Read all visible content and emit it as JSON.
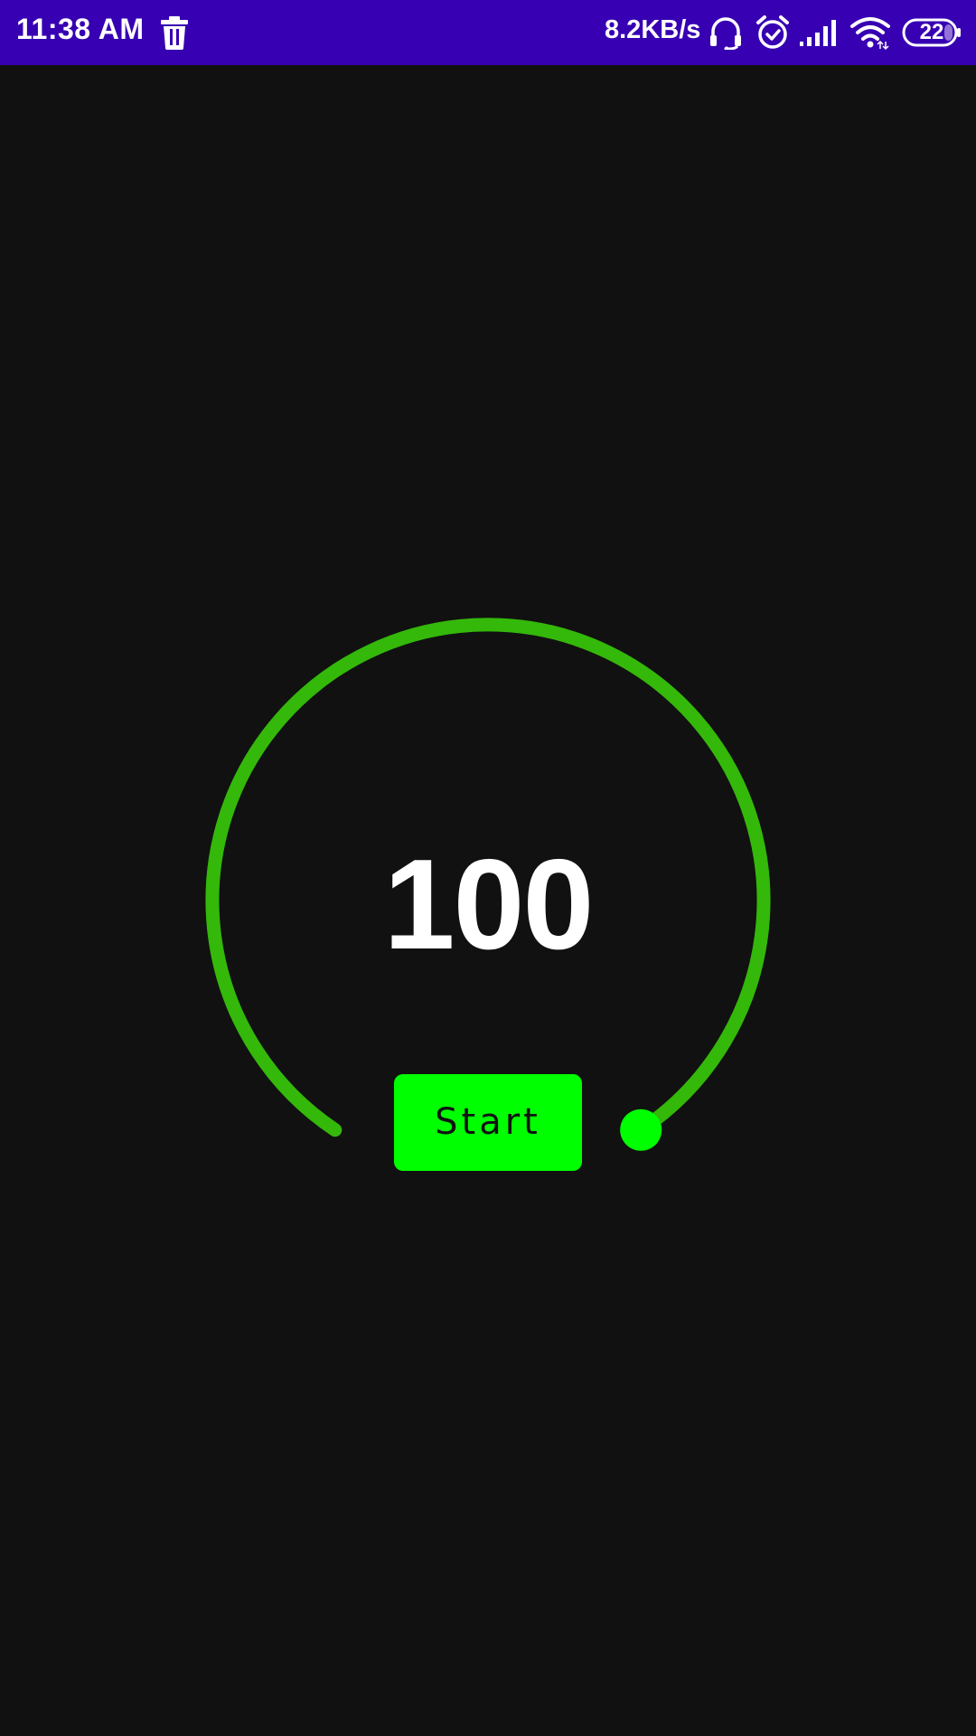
{
  "status_bar": {
    "time": "11:38 AM",
    "network_speed": "8.2KB/s",
    "battery_level": "22",
    "icons": [
      "trash-icon",
      "headset-icon",
      "alarm-icon",
      "signal-icon",
      "wifi-icon",
      "battery-icon"
    ],
    "background_color": "#3700b3"
  },
  "gauge": {
    "value": "100",
    "progress_fraction": 1.0,
    "arc_color": "#34b80a",
    "thumb_color": "#00ff00"
  },
  "start_button": {
    "label": "Start",
    "color": "#00ff00"
  },
  "theme": {
    "background": "#111111"
  }
}
